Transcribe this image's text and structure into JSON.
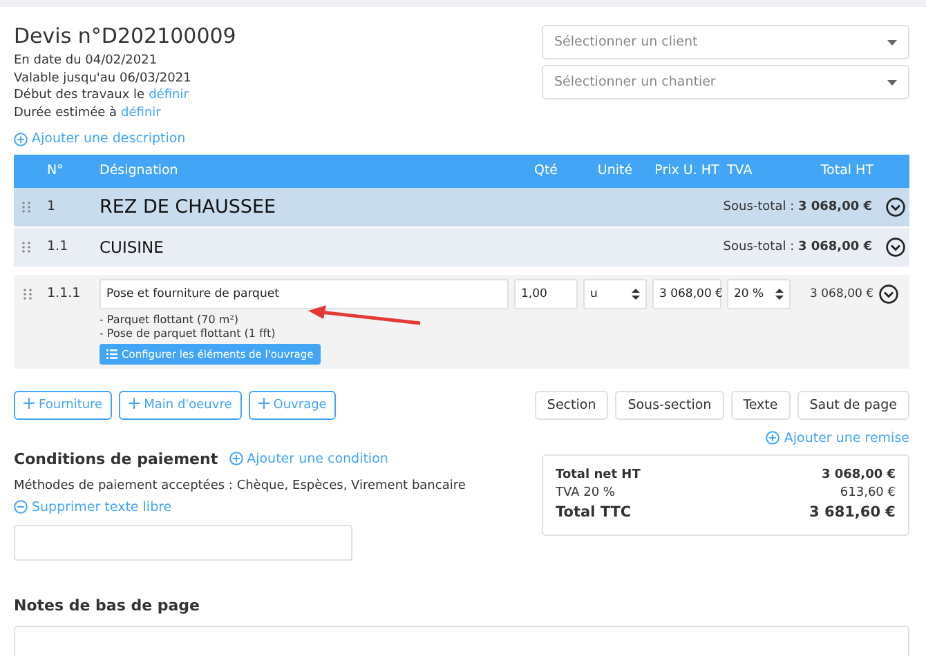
{
  "title": "Devis n°D202100009",
  "meta": [
    {
      "text": "En date du 04/02/2021"
    },
    {
      "text": "Valable jusqu'au 06/03/2021"
    },
    {
      "text": "Début des travaux le",
      "link": "définir"
    },
    {
      "text": "Durée estimée à",
      "link": "définir"
    }
  ],
  "selects": [
    {
      "placeholder": "Sélectionner un client"
    },
    {
      "placeholder": "Sélectionner un chantier"
    }
  ],
  "add_description": "Ajouter une description",
  "table": {
    "columns": [
      "N°",
      "Désignation",
      "Qté",
      "Unité",
      "Prix U. HT",
      "TVA",
      "Total HT"
    ],
    "rows": [
      {
        "kind": "section",
        "number": "1",
        "label": "REZ DE CHAUSSEE",
        "subtotal": "Sous-total : **3 068,00 €**"
      },
      {
        "kind": "subsection",
        "number": "1.1",
        "label": "CUISINE",
        "subtotal": "Sous-total : **3 068,00 €**"
      },
      {
        "kind": "item",
        "number": "1.1.1",
        "label": "Pose et fourniture de parquet",
        "qty": "1,00",
        "unit": "u",
        "price": "3 068,00 €",
        "vat": "20 %",
        "total": "3 068,00 €",
        "details": [
          "- Parquet flottant (70 m²)",
          "- Pose de parquet flottant (1 fft)"
        ],
        "configure": "Configurer les éléments de l'ouvrage"
      }
    ]
  },
  "add_buttons": [
    "Fourniture",
    "Main d'oeuvre",
    "Ouvrage"
  ],
  "insert_buttons": [
    "Section",
    "Sous-section",
    "Texte",
    "Saut de page"
  ],
  "payment": {
    "title": "Conditions de paiement",
    "add": "Ajouter une condition",
    "methods": "Méthodes de paiement acceptées : Chèque, Espèces, Virement bancaire",
    "remove": "Supprimer texte libre"
  },
  "add_discount": "Ajouter une remise",
  "totals": [
    {
      "kind": "bold",
      "label": "Total net HT",
      "value": "3 068,00 €"
    },
    {
      "kind": "plain",
      "label": "TVA 20 %",
      "value": "613,60 €"
    },
    {
      "kind": "grand",
      "label": "Total TTC",
      "value": "3 681,60 €"
    }
  ],
  "footer_notes": {
    "title": "Notes de bas de page"
  }
}
